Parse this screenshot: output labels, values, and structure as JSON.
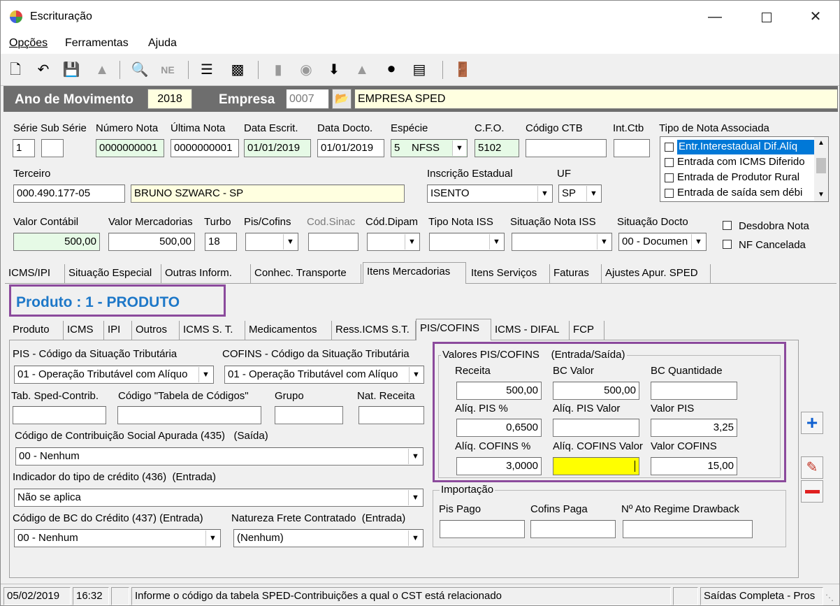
{
  "window": {
    "title": "Escrituração"
  },
  "menu": [
    "Opções",
    "Ferramentas",
    "Ajuda"
  ],
  "header": {
    "ano_label": "Ano de Movimento",
    "ano_value": "2018",
    "empresa_label": "Empresa",
    "empresa_code": "0007",
    "empresa_name": "EMPRESA SPED"
  },
  "nota": {
    "serie_label": "Série",
    "serie": "1",
    "subserie_label": "Sub Série",
    "subserie": "",
    "numero_label": "Número Nota",
    "numero": "0000000001",
    "ultima_label": "Última Nota",
    "ultima": "0000000001",
    "data_escrit_label": "Data Escrit.",
    "data_escrit": "01/01/2019",
    "data_docto_label": "Data Docto.",
    "data_docto": "01/01/2019",
    "especie_label": "Espécie",
    "especie": "5    NFSS",
    "cfo_label": "C.F.O.",
    "cfo": "5102",
    "codigo_ctb_label": "Código CTB",
    "codigo_ctb": "",
    "int_ctb_label": "Int.Ctb",
    "int_ctb": "",
    "tipo_assoc_label": "Tipo de Nota Associada",
    "tipo_assoc_items": [
      "Entr.Interestadual Dif.Alíq",
      "Entrada com ICMS Diferido",
      "Entrada de Produtor Rural",
      "Entrada de saída sem débi"
    ],
    "terceiro_label": "Terceiro",
    "terceiro_code": "000.490.177-05",
    "terceiro_name": "BRUNO SZWARC - SP",
    "ie_label": "Inscrição Estadual",
    "ie": "ISENTO",
    "uf_label": "UF",
    "uf": "SP",
    "valor_contabil_label": "Valor Contábil",
    "valor_contabil": "500,00",
    "valor_merc_label": "Valor Mercadorias",
    "valor_merc": "500,00",
    "turbo_label": "Turbo",
    "turbo": "18",
    "piscofins_label": "Pis/Cofins",
    "codsinac_label": "Cod.Sinac",
    "coddipam_label": "Cód.Dipam",
    "tipo_iss_label": "Tipo Nota ISS",
    "sit_iss_label": "Situação Nota ISS",
    "sit_docto_label": "Situação Docto",
    "sit_docto": "00 - Documen",
    "desdobra_label": "Desdobra Nota",
    "cancelada_label": "NF Cancelada"
  },
  "tabs_main": [
    "ICMS/IPI",
    "Situação Especial",
    "Outras Inform.",
    "Conhec. Transporte",
    "Itens Mercadorias",
    "Itens Serviços",
    "Faturas",
    "Ajustes Apur. SPED"
  ],
  "produto_title": "Produto : 1 - PRODUTO",
  "tabs_item": [
    "Produto",
    "ICMS",
    "IPI",
    "Outros",
    "ICMS S. T.",
    "Medicamentos",
    "Ress.ICMS S.T.",
    "PIS/COFINS",
    "ICMS - DIFAL",
    "FCP"
  ],
  "pis": {
    "pis_cst_label": "PIS - Código da Situação Tributária",
    "pis_cst": "01 - Operação Tributável com Alíquo",
    "cofins_cst_label": "COFINS - Código da Situação Tributária",
    "cofins_cst": "01 - Operação Tributável com Alíquo",
    "tab_sped_label": "Tab. Sped-Contrib.",
    "cod_tabela_label": "Código \"Tabela de Códigos\"",
    "grupo_label": "Grupo",
    "nat_receita_label": "Nat. Receita",
    "cod_contrib_label": "Código de Contribuição Social Apurada (435)   (Saída)",
    "cod_contrib": "00 - Nenhum",
    "ind_credito_label": "Indicador do tipo de crédito (436)  (Entrada)",
    "ind_credito": "Não se aplica",
    "cod_bc_label": "Código de BC do Crédito (437) (Entrada)",
    "cod_bc": "00 - Nenhum",
    "nat_frete_label": "Natureza Frete Contratado  (Entrada)",
    "nat_frete": "(Nenhum)"
  },
  "valores": {
    "group_label": "Valores PIS/COFINS    (Entrada/Saída)",
    "receita_label": "Receita",
    "receita": "500,00",
    "bc_valor_label": "BC Valor",
    "bc_valor": "500,00",
    "bc_qtd_label": "BC Quantidade",
    "bc_qtd": "",
    "aliq_pis_label": "Alíq. PIS %",
    "aliq_pis": "0,6500",
    "aliq_pis_valor_label": "Alíq. PIS Valor",
    "aliq_pis_valor": "",
    "valor_pis_label": "Valor PIS",
    "valor_pis": "3,25",
    "aliq_cofins_label": "Alíq. COFINS %",
    "aliq_cofins": "3,0000",
    "aliq_cofins_valor_label": "Alíq. COFINS Valor",
    "aliq_cofins_valor": "",
    "valor_cofins_label": "Valor COFINS",
    "valor_cofins": "15,00"
  },
  "importacao": {
    "group_label": "Importação",
    "pis_pago_label": "Pis Pago",
    "cofins_paga_label": "Cofins Paga",
    "ato_label": "Nº Ato Regime Drawback"
  },
  "statusbar": {
    "date": "05/02/2019",
    "time": "16:32",
    "message": "Informe o código da tabela SPED-Contribuições a qual o CST está relacionado",
    "mode": "Saídas Completa - Pros"
  }
}
